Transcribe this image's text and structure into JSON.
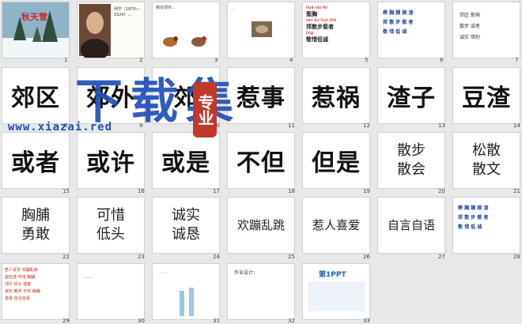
{
  "slides": [
    {
      "n": "1",
      "kind": "photo",
      "title": "秋天雪"
    },
    {
      "n": "2",
      "kind": "portrait",
      "text": "列宁（1870—1924）…"
    },
    {
      "n": "3",
      "kind": "birds",
      "text": "我在郊外…"
    },
    {
      "n": "4",
      "kind": "bird-text",
      "text": "…"
    },
    {
      "n": "5",
      "kind": "pinyin",
      "pinyin": [
        "huā ráo fèi",
        "wǎn zhā",
        "jiāo",
        "sàn bù huò zhě",
        "wǎn xī",
        "gào sù",
        "jìng",
        "dī",
        "chéng"
      ],
      "chars": [
        "惹胸",
        "捕捉",
        "郊散步惹者",
        "敬惜低诚"
      ]
    },
    {
      "n": "6",
      "kind": "bluechars",
      "rows": [
        "榫 胸 脯 婉 渣",
        "郊 散 步 惹 者",
        "敬 惜 低 诚"
      ]
    },
    {
      "n": "7",
      "kind": "words",
      "rows": [
        "郊区  惹祸",
        "散步  或者",
        "诚实  惜别"
      ]
    },
    {
      "n": "8",
      "text": "郊区"
    },
    {
      "n": "9",
      "text": "郊外"
    },
    {
      "n": "10",
      "text": "郊"
    },
    {
      "n": "11",
      "text": "惹事"
    },
    {
      "n": "12",
      "text": "惹祸"
    },
    {
      "n": "13",
      "text": "渣子"
    },
    {
      "n": "14",
      "text": "豆渣"
    },
    {
      "n": "15",
      "text": "或者"
    },
    {
      "n": "16",
      "text": "或许"
    },
    {
      "n": "17",
      "text": "或是"
    },
    {
      "n": "18",
      "text": "不但"
    },
    {
      "n": "19",
      "text": "但是"
    },
    {
      "n": "20",
      "lines": [
        "散步",
        "散会"
      ]
    },
    {
      "n": "21",
      "lines": [
        "松散",
        "散文"
      ]
    },
    {
      "n": "22",
      "lines": [
        "胸脯",
        "勇敢"
      ]
    },
    {
      "n": "23",
      "lines": [
        "可惜",
        "低头"
      ]
    },
    {
      "n": "24",
      "lines": [
        "诚实",
        "诚恳"
      ]
    },
    {
      "n": "25",
      "text": "欢蹦乱跳"
    },
    {
      "n": "26",
      "text": "惹人喜爱"
    },
    {
      "n": "27",
      "text": "自言自语"
    },
    {
      "n": "28",
      "rows": [
        "榫 胸 脯 婉 渣",
        "郊 散 步 惹 者",
        "敬 惜 低 诚"
      ]
    },
    {
      "n": "29",
      "rows": [
        "惹人喜爱  欢蹦乱跳",
        "面包渣 可惜 胸脯",
        "郊外 低头 或者",
        "诚实 散步 示实 胸脯",
        "勇敢 自言自语"
      ]
    },
    {
      "n": "30",
      "text": "……"
    },
    {
      "n": "31",
      "text": "……"
    },
    {
      "n": "32",
      "text": "作业设计："
    },
    {
      "n": "33",
      "text": "第1PPT"
    }
  ],
  "watermark": {
    "main": "下载集",
    "side": "专业",
    "url": "www.xiazai.red"
  }
}
